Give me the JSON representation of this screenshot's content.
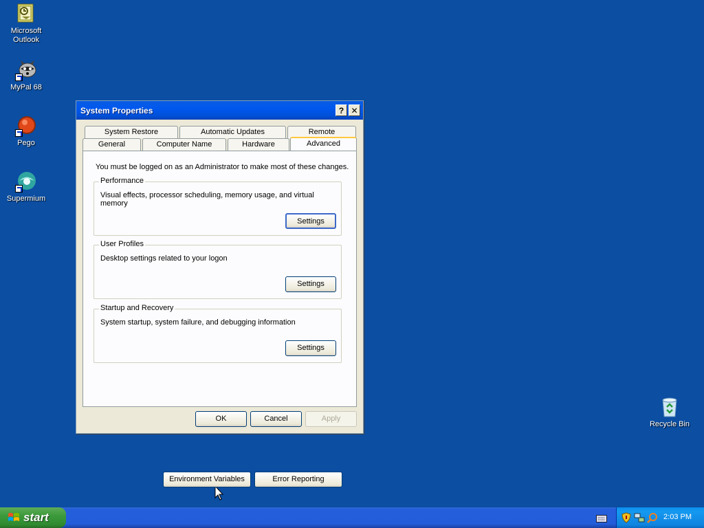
{
  "desktop": {
    "icons": [
      {
        "label": "Microsoft Outlook",
        "icon": "outlook-icon"
      },
      {
        "label": "MyPal 68",
        "icon": "raccoon-icon"
      },
      {
        "label": "Pego",
        "icon": "pego-icon"
      },
      {
        "label": "Supermium",
        "icon": "supermium-icon"
      },
      {
        "label": "Recycle Bin",
        "icon": "recycle-bin-icon"
      }
    ]
  },
  "window": {
    "title": "System Properties",
    "help_btn": "?",
    "close_btn": "✕",
    "tabs_row1": [
      "System Restore",
      "Automatic Updates",
      "Remote"
    ],
    "tabs_row2": [
      "General",
      "Computer Name",
      "Hardware",
      "Advanced"
    ],
    "active_tab": "Advanced",
    "notice": "You must be logged on as an Administrator to make most of these changes.",
    "groups": [
      {
        "title": "Performance",
        "desc": "Visual effects, processor scheduling, memory usage, and virtual memory",
        "button": "Settings"
      },
      {
        "title": "User Profiles",
        "desc": "Desktop settings related to your logon",
        "button": "Settings"
      },
      {
        "title": "Startup and Recovery",
        "desc": "System startup, system failure, and debugging information",
        "button": "Settings"
      }
    ],
    "env_button": "Environment Variables",
    "error_button": "Error Reporting",
    "ok": "OK",
    "cancel": "Cancel",
    "apply": "Apply"
  },
  "taskbar": {
    "start_label": "start",
    "clock": "2:03 PM"
  },
  "colors": {
    "desktop_bg": "#0b4ea2",
    "titlebar": "#0058ee",
    "start_green": "#3c9a3c",
    "tray_blue": "#0f84e0"
  }
}
